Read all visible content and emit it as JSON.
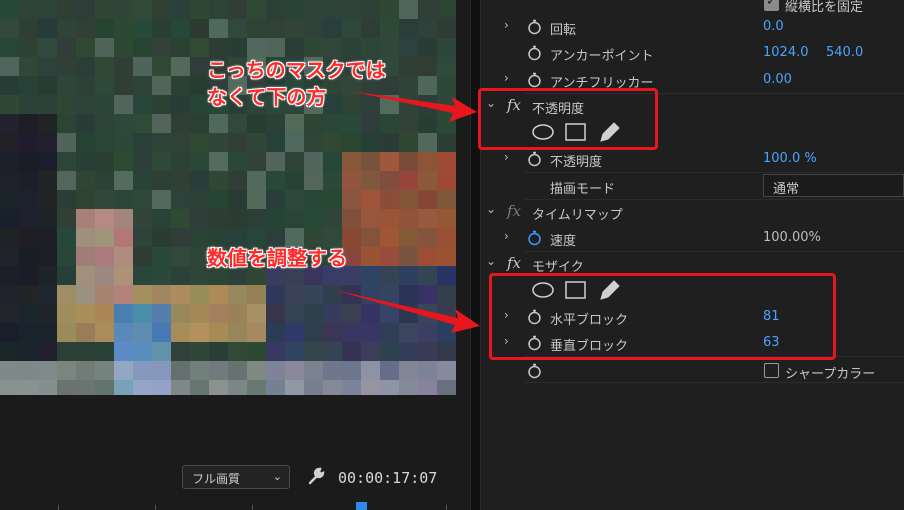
{
  "monitor": {
    "quality": "フル画質",
    "timecode": "00:00:17:07"
  },
  "effect_controls": {
    "top": {
      "uniform_scale_label": "縦横比を固定",
      "rotation_label": "回転",
      "rotation_value": "0.0",
      "anchor_label": "アンカーポイント",
      "anchor_x": "1024.0",
      "anchor_y": "540.0",
      "flicker_label": "アンチフリッカー",
      "flicker_value": "0.00"
    },
    "opacity": {
      "header": "不透明度",
      "fx_icon": "fx",
      "opacity_label": "不透明度",
      "opacity_value": "100.0 %",
      "blend_label": "描画モード",
      "blend_value": "通常"
    },
    "time_remap": {
      "header": "タイムリマップ",
      "fx_icon": "fx",
      "speed_label": "速度",
      "speed_value": "100.00%"
    },
    "mosaic": {
      "header": "モザイク",
      "fx_icon": "fx",
      "horizontal_label": "水平ブロック",
      "horizontal_value": "81",
      "vertical_label": "垂直ブロック",
      "vertical_value": "63",
      "sharp_colors_label": "シャープカラー"
    }
  },
  "annotations": {
    "note1_line1": "こっちのマスクでは",
    "note1_line2": "なくて下の方",
    "note2": "数値を調整する"
  },
  "colors": {
    "accent_value": "#4aa3ff",
    "annotation_red": "#e8161d",
    "panel_bg": "#1f1f1f"
  }
}
